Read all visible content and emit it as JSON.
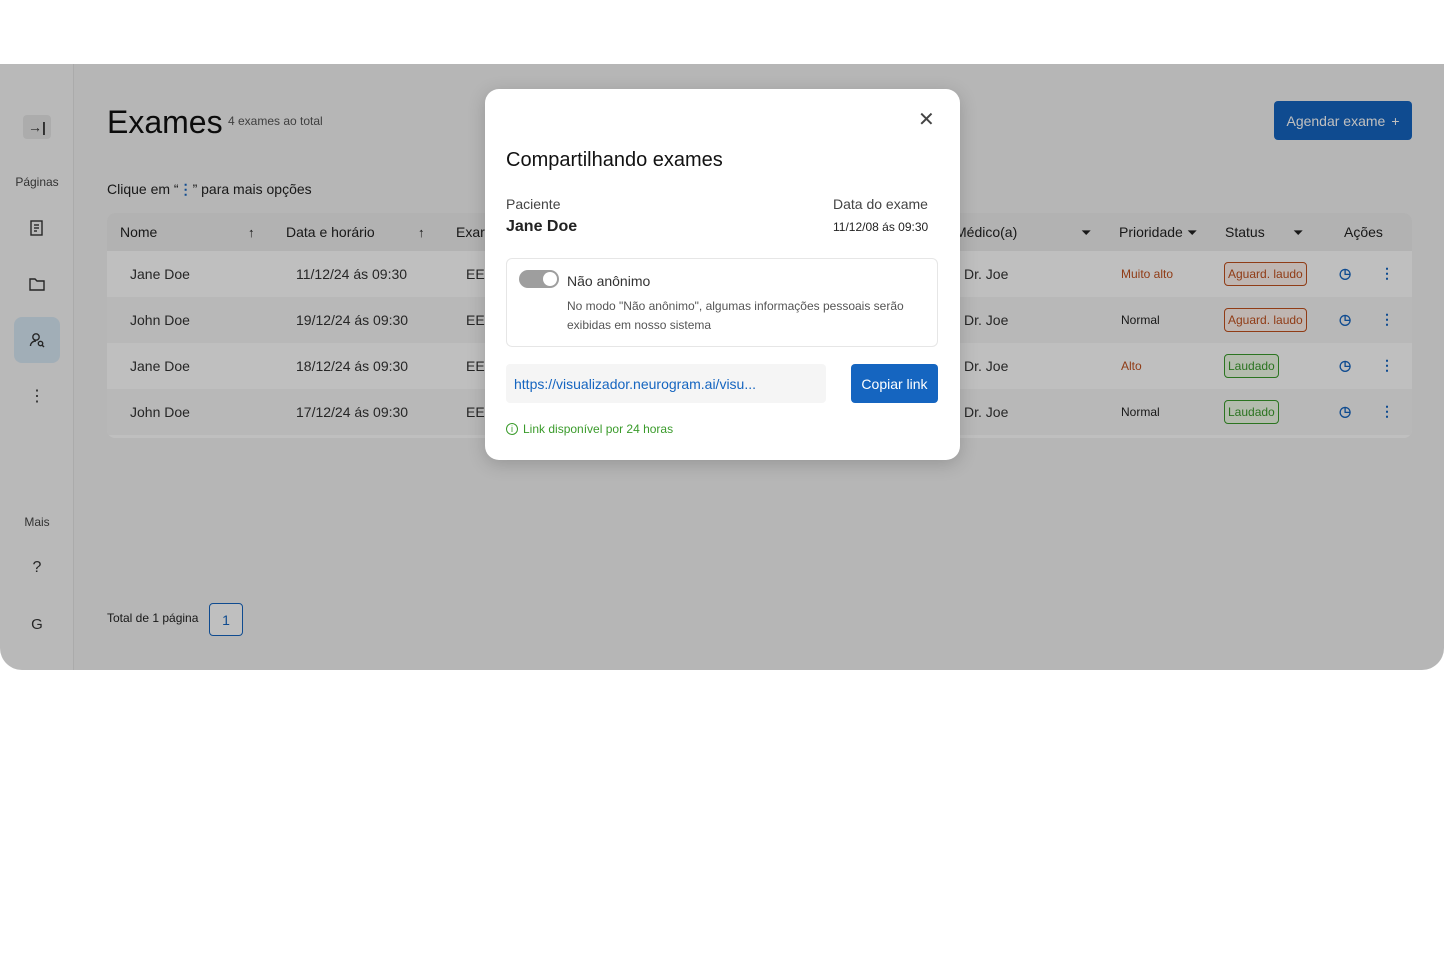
{
  "sidebar": {
    "collapse_icon": "collapse-arrow-icon",
    "collapse_glyph": "→|",
    "pages_label": "Páginas",
    "more_label": "Mais",
    "more_glyph": "⋮",
    "help_glyph": "?",
    "logout_glyph": "G"
  },
  "page": {
    "title": "Exames",
    "count": "4 exames ao total",
    "hint_prefix": "Clique em “",
    "hint_dots": "⋮",
    "hint_suffix": "” para mais opções",
    "schedule_button": "Agendar exame",
    "schedule_plus": "+"
  },
  "table": {
    "headers": {
      "name": "Nome",
      "date": "Data e horário",
      "exam": "Exar",
      "doctor": "Médico(a)",
      "priority": "Prioridade",
      "status": "Status",
      "actions": "Ações"
    },
    "rows": [
      {
        "name": "Jane Doe",
        "date": "11/12/24 ás 09:30",
        "exam": "EE",
        "doctor": "Dr. Joe",
        "priority": "Muito alto",
        "status": "Aguard. laudo"
      },
      {
        "name": "John Doe",
        "date": "19/12/24 ás 09:30",
        "exam": "EE",
        "doctor": "Dr. Joe",
        "priority": "Normal",
        "status": "Aguard. laudo"
      },
      {
        "name": "Jane Doe",
        "date": "18/12/24 ás 09:30",
        "exam": "EE",
        "doctor": "Dr. Joe",
        "priority": "Alto",
        "status": "Laudado"
      },
      {
        "name": "John Doe",
        "date": "17/12/24 ás 09:30",
        "exam": "EE",
        "doctor": "Dr. Joe",
        "priority": "Normal",
        "status": "Laudado"
      }
    ]
  },
  "pager": {
    "label": "Total de 1 página",
    "page": "1"
  },
  "modal": {
    "close_glyph": "✕",
    "title": "Compartilhando exames",
    "patient_label": "Paciente",
    "patient_name": "Jane Doe",
    "date_label": "Data do exame",
    "date_value": "11/12/08 ás 09:30",
    "toggle_label": "Não anônimo",
    "toggle_desc": "No modo \"Não anônimo\", algumas informações pessoais serão exibidas em nosso sistema",
    "link_value": "https://visualizador.neurogram.ai/visu...",
    "copy_button": "Copiar link",
    "info_glyph": "i",
    "info_text": "Link disponível por 24 horas"
  },
  "colors": {
    "primary": "#1565c0",
    "danger": "#c0501e",
    "success": "#3a9b2b"
  }
}
